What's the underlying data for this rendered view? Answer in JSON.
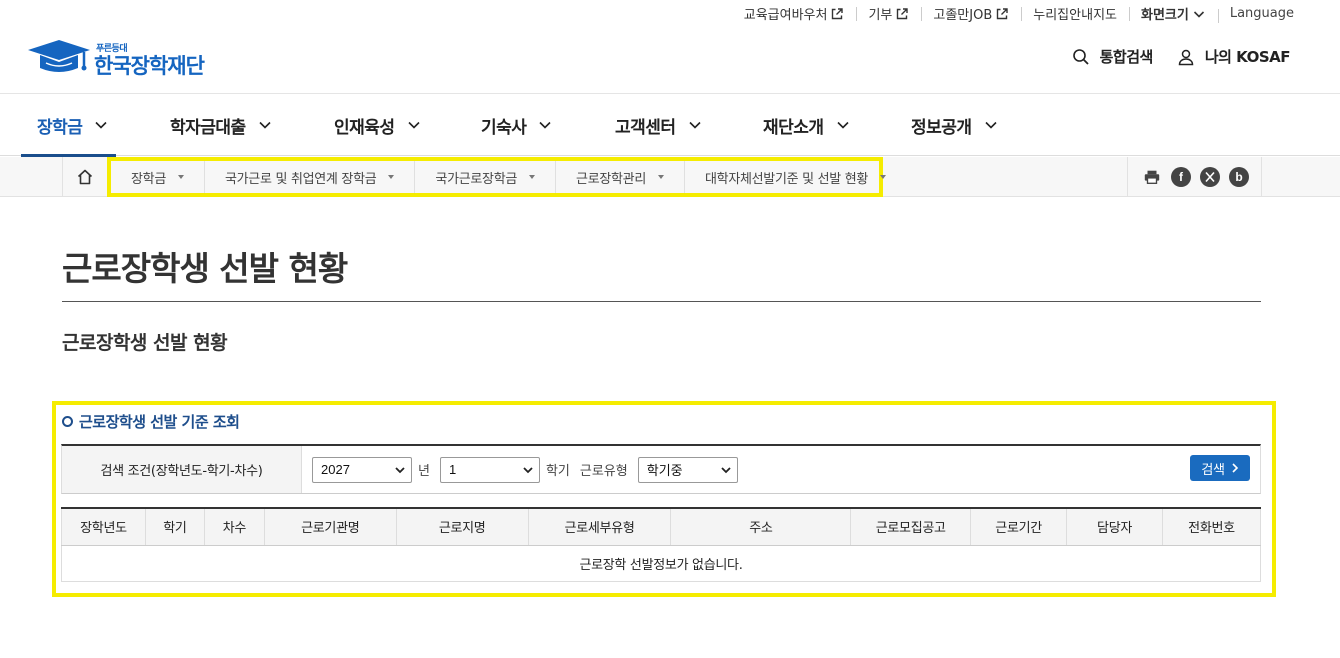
{
  "util_bar": {
    "items": [
      {
        "label": "교육급여바우처",
        "external": true
      },
      {
        "label": "기부",
        "external": true
      },
      {
        "label": "고졸만JOB",
        "external": true
      },
      {
        "label": "누리집안내지도",
        "external": false
      }
    ],
    "font_size": "화면크기",
    "language": "Language"
  },
  "logo": {
    "small_text": "푸른등대",
    "main_text": "한국장학재단"
  },
  "header_right": {
    "search": "통합검색",
    "my": "나의 KOSAF"
  },
  "gnb": {
    "items": [
      {
        "label": "장학금",
        "active": true
      },
      {
        "label": "학자금대출"
      },
      {
        "label": "인재육성"
      },
      {
        "label": "기숙사"
      },
      {
        "label": "고객센터"
      },
      {
        "label": "재단소개"
      },
      {
        "label": "정보공개"
      }
    ]
  },
  "lnb": {
    "items": [
      "장학금",
      "국가근로 및 취업연계 장학금",
      "국가근로장학금",
      "근로장학관리",
      "대학자체선발기준 및 선발 현황"
    ]
  },
  "page": {
    "title": "근로장학생 선발 현황",
    "subtitle": "근로장학생 선발 현황"
  },
  "search_section": {
    "heading": "근로장학생 선발 기준 조회",
    "label": "검색 조건(장학년도-학기-차수)",
    "year_value": "2027",
    "year_suffix": "년",
    "semester_value": "1",
    "semester_suffix": "학기",
    "type_label": "근로유형",
    "type_value": "학기중",
    "button": "검색"
  },
  "table": {
    "headers": [
      "장학년도",
      "학기",
      "차수",
      "근로기관명",
      "근로지명",
      "근로세부유형",
      "주소",
      "근로모집공고",
      "근로기간",
      "담당자",
      "전화번호"
    ],
    "empty_message": "근로장학 선발정보가 없습니다."
  }
}
